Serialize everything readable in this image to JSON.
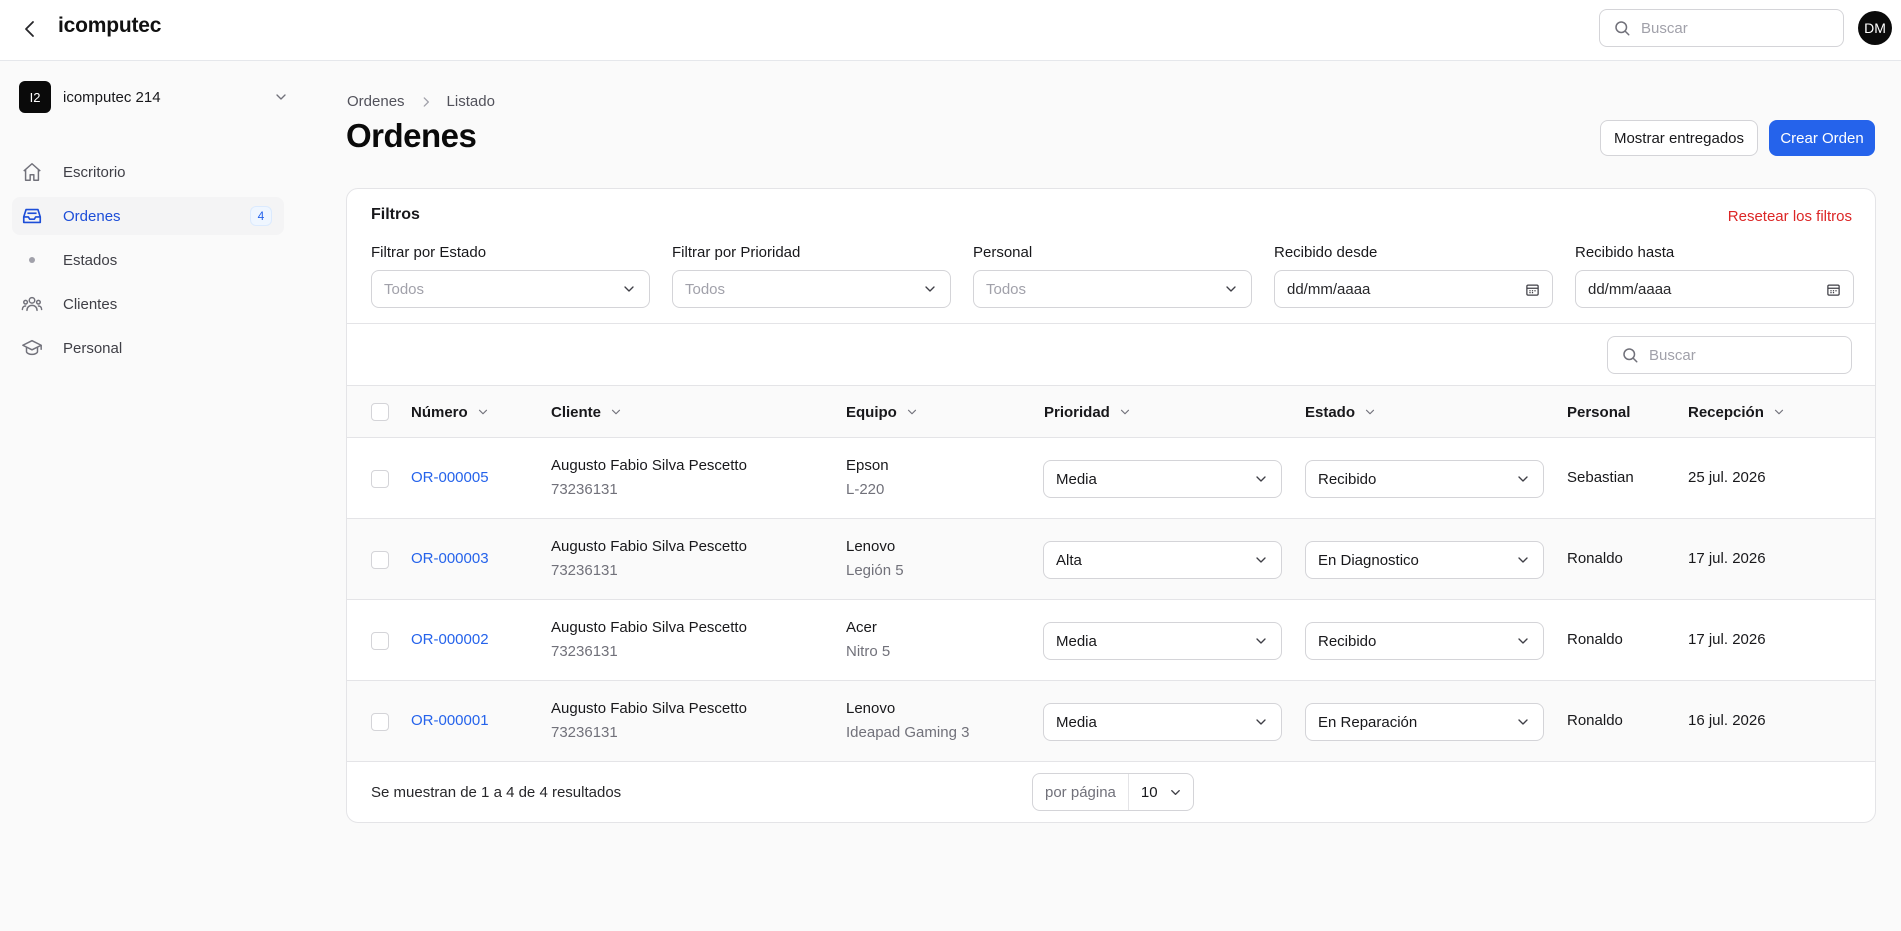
{
  "topbar": {
    "brand": "icomputec",
    "search_placeholder": "Buscar",
    "avatar_initials": "DM"
  },
  "sidebar": {
    "tenant": {
      "initials": "I2",
      "name": "icomputec 214"
    },
    "items": [
      {
        "label": "Escritorio",
        "icon": "home-icon"
      },
      {
        "label": "Ordenes",
        "icon": "inbox-icon",
        "badge": "4",
        "active": true
      },
      {
        "label": "Estados",
        "icon": "dot-icon"
      },
      {
        "label": "Clientes",
        "icon": "users-icon"
      },
      {
        "label": "Personal",
        "icon": "academic-cap-icon"
      }
    ]
  },
  "breadcrumb": {
    "root": "Ordenes",
    "current": "Listado"
  },
  "page": {
    "title": "Ordenes",
    "show_delivered_label": "Mostrar entregados",
    "create_label": "Crear Orden"
  },
  "filters": {
    "title": "Filtros",
    "reset_label": "Resetear los filtros",
    "estado": {
      "label": "Filtrar por Estado",
      "placeholder": "Todos"
    },
    "prioridad": {
      "label": "Filtrar por Prioridad",
      "placeholder": "Todos"
    },
    "personal": {
      "label": "Personal",
      "placeholder": "Todos"
    },
    "desde": {
      "label": "Recibido desde",
      "value": "dd/mm/aaaa"
    },
    "hasta": {
      "label": "Recibido hasta",
      "value": "dd/mm/aaaa"
    }
  },
  "table": {
    "search_placeholder": "Buscar",
    "columns": {
      "numero": "Número",
      "cliente": "Cliente",
      "equipo": "Equipo",
      "prioridad": "Prioridad",
      "estado": "Estado",
      "personal": "Personal",
      "recepcion": "Recepción"
    },
    "rows": [
      {
        "numero": "OR-000005",
        "cliente": "Augusto Fabio Silva Pescetto",
        "cliente_id": "73236131",
        "marca": "Epson",
        "modelo": "L-220",
        "prioridad": "Media",
        "estado": "Recibido",
        "personal": "Sebastian",
        "recepcion": "25 jul. 2026"
      },
      {
        "numero": "OR-000003",
        "cliente": "Augusto Fabio Silva Pescetto",
        "cliente_id": "73236131",
        "marca": "Lenovo",
        "modelo": "Legión 5",
        "prioridad": "Alta",
        "estado": "En Diagnostico",
        "personal": "Ronaldo",
        "recepcion": "17 jul. 2026"
      },
      {
        "numero": "OR-000002",
        "cliente": "Augusto Fabio Silva Pescetto",
        "cliente_id": "73236131",
        "marca": "Acer",
        "modelo": "Nitro 5",
        "prioridad": "Media",
        "estado": "Recibido",
        "personal": "Ronaldo",
        "recepcion": "17 jul. 2026"
      },
      {
        "numero": "OR-000001",
        "cliente": "Augusto Fabio Silva Pescetto",
        "cliente_id": "73236131",
        "marca": "Lenovo",
        "modelo": "Ideapad Gaming 3",
        "prioridad": "Media",
        "estado": "En Reparación",
        "personal": "Ronaldo",
        "recepcion": "16 jul. 2026"
      }
    ],
    "footer": {
      "summary": "Se muestran de 1 a 4 de 4 resultados",
      "per_page_label": "por página",
      "per_page_value": "10"
    }
  },
  "colors": {
    "accent": "#2563eb",
    "danger": "#dc2626",
    "text": "#18181b",
    "muted": "#71717a"
  }
}
